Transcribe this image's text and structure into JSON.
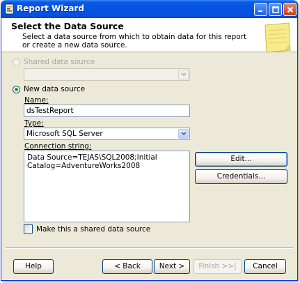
{
  "window": {
    "title": "Report Wizard",
    "icon": "report-wizard-icon"
  },
  "header": {
    "title": "Select the Data Source",
    "description": "Select a data source from which to obtain data for this report or create a new data source."
  },
  "shared_source": {
    "label": "Shared data source",
    "selected": false,
    "enabled": false,
    "value": ""
  },
  "new_source": {
    "label": "New data source",
    "selected": true,
    "name_label": "Name:",
    "name_value": "dsTestReport",
    "type_label": "Type:",
    "type_value": "Microsoft SQL Server",
    "conn_label": "Connection string:",
    "conn_value": "Data Source=TEJAS\\SQL2008;Initial\nCatalog=AdventureWorks2008",
    "edit_label": "Edit...",
    "credentials_label": "Credentials...",
    "shared_checkbox_label": "Make this a shared data source",
    "shared_checkbox_checked": false
  },
  "footer": {
    "help_label": "Help",
    "back_label": "< Back",
    "next_label": "Next >",
    "finish_label": "Finish >>|",
    "cancel_label": "Cancel"
  },
  "colors": {
    "titlebar": "#0453de",
    "dialog_bg": "#ece9d8",
    "radio_dot": "#21a121"
  }
}
